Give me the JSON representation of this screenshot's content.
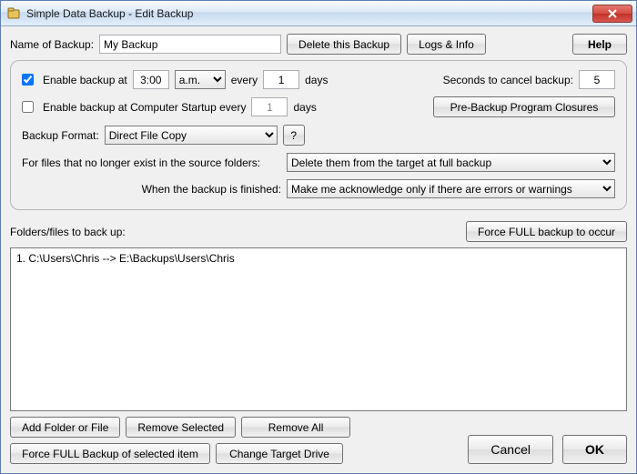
{
  "window": {
    "title": "Simple Data Backup - Edit Backup"
  },
  "toolbar": {
    "name_label": "Name of Backup:",
    "name_value": "My Backup",
    "delete_btn": "Delete this Backup",
    "logs_btn": "Logs & Info",
    "help_btn": "Help"
  },
  "schedule": {
    "enable_time_label": "Enable backup at",
    "time_value": "3:00",
    "ampm": "a.m.",
    "every_label": "every",
    "every_value": "1",
    "days_label": "days",
    "seconds_label": "Seconds to cancel backup:",
    "seconds_value": "5",
    "enable_startup_label": "Enable backup at Computer Startup every",
    "startup_every_value": "1",
    "startup_days_label": "days",
    "preclosures_btn": "Pre-Backup Program Closures",
    "format_label": "Backup Format:",
    "format_value": "Direct File Copy",
    "helpq": "?",
    "deleted_files_label": "For files that no longer exist in the source folders:",
    "deleted_files_value": "Delete them from the target at full backup",
    "when_finished_label": "When the backup is finished:",
    "when_finished_value": "Make me acknowledge only if there are errors or warnings"
  },
  "folders": {
    "label": "Folders/files to back up:",
    "force_full_btn": "Force FULL backup to occur",
    "items": [
      "1. C:\\Users\\Chris --> E:\\Backups\\Users\\Chris"
    ]
  },
  "actions": {
    "add": "Add Folder or File",
    "remove_sel": "Remove Selected",
    "remove_all": "Remove All",
    "force_sel": "Force FULL Backup of selected item",
    "change_drive": "Change Target Drive",
    "cancel": "Cancel",
    "ok": "OK"
  }
}
